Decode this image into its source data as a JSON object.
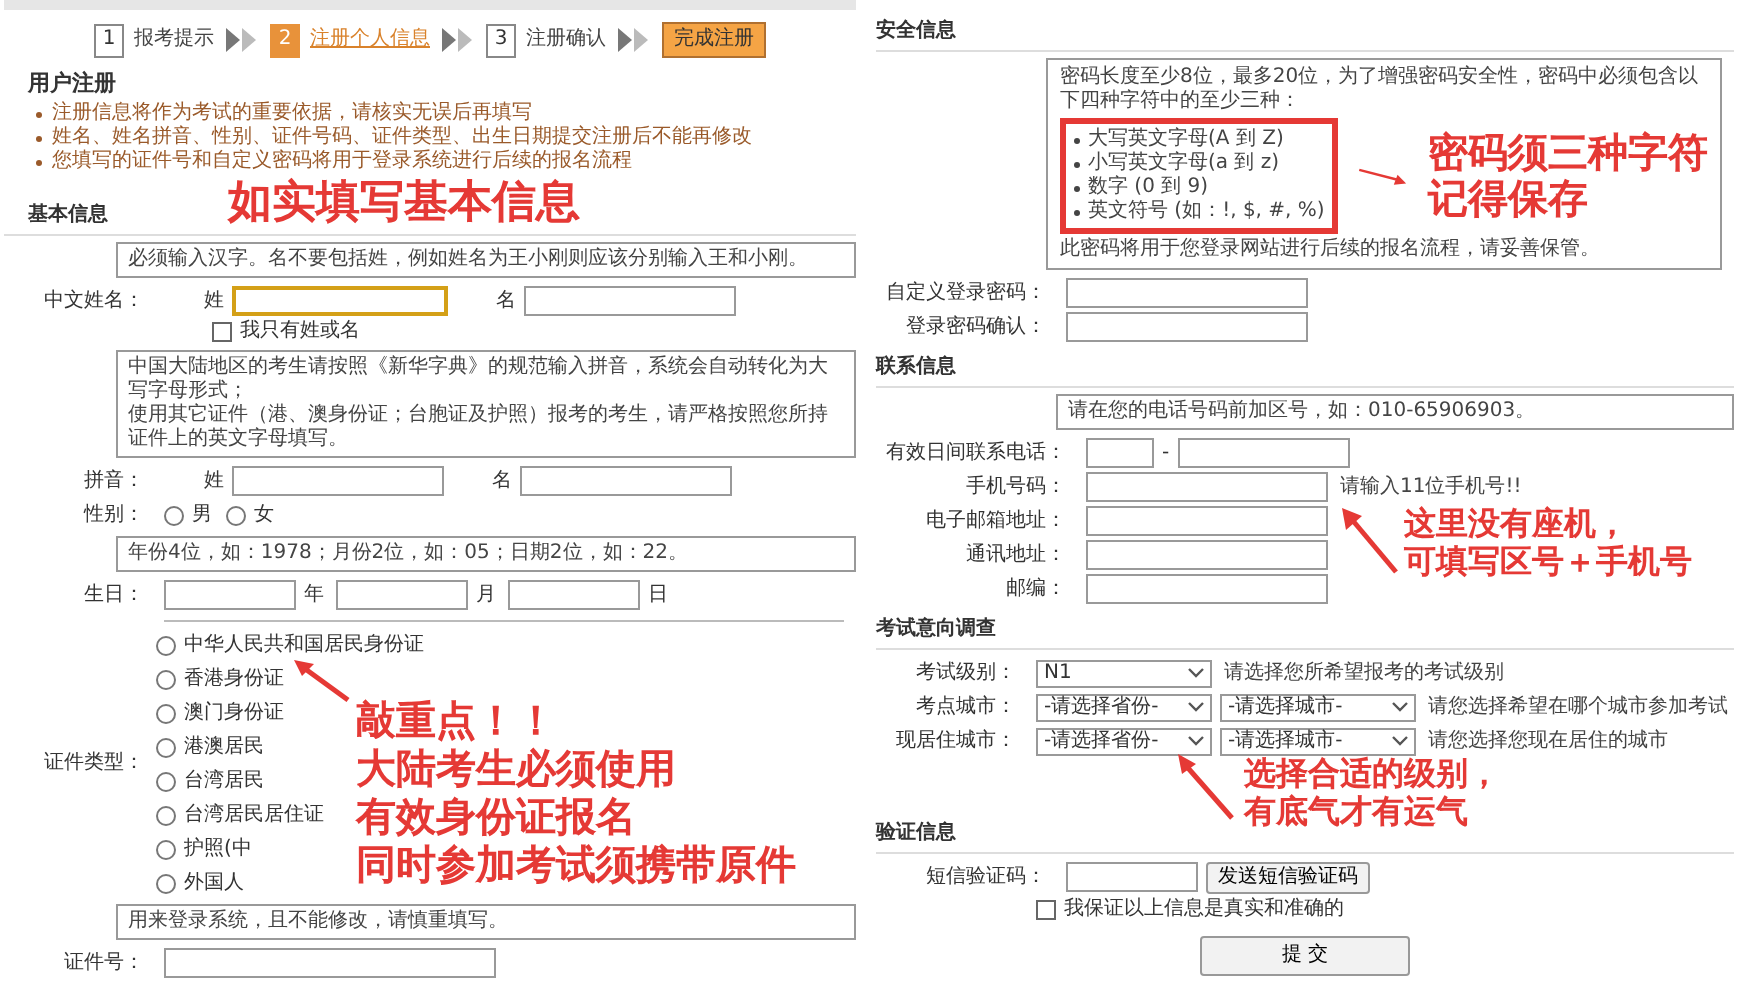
{
  "registration": {
    "steps": [
      {
        "number": "1",
        "label": "报考提示",
        "selected": false
      },
      {
        "number": "2",
        "label": "注册个人信息",
        "selected": true
      },
      {
        "number": "3",
        "label": "注册确认",
        "selected": false
      }
    ],
    "finish_label": "完成注册",
    "title": "用户注册",
    "notices": [
      "注册信息将作为考试的重要依据，请核实无误后再填写",
      "姓名、姓名拼音、性别、证件号码、证件类型、出生日期提交注册后不能再修改",
      "您填写的证件号和自定义密码将用于登录系统进行后续的报名流程"
    ],
    "basic": {
      "title": "基本信息",
      "annotation": "如实填写基本信息",
      "name_hint": "必须输入汉字。名不要包括姓，例如姓名为王小刚则应该分别输入王和小刚。",
      "name_label": "中文姓名：",
      "name_fields": [
        {
          "label": "姓",
          "focused": true
        },
        {
          "label": "名",
          "focused": false
        }
      ],
      "single_name": {
        "label": "我只有姓或名",
        "checked": false
      },
      "pinyin_hint": [
        "中国大陆地区的考生请按照《新华字典》的规范输入拼音，系统会自动转化为大写字母形式；",
        "使用其它证件（港、澳身份证；台胞证及护照）报考的考生，请严格按照您所持证件上的英文字母填写。"
      ],
      "pinyin_label": "拼音：",
      "pinyin_fields": [
        {
          "label": "姓",
          "focused": false
        },
        {
          "label": "名",
          "focused": false
        }
      ],
      "gender_label": "性别：",
      "genders": [
        {
          "label": "男",
          "selected": false
        },
        {
          "label": "女",
          "selected": false
        }
      ],
      "birth_hint": "年份4位，如：1978；月份2位，如：05；日期2位，如：22。",
      "birth_label": "生日：",
      "birth_units": [
        "年",
        "月",
        "日"
      ],
      "id_type_label": "证件类型：",
      "id_types": [
        {
          "label": "中华人民共和国居民身份证",
          "selected": false
        },
        {
          "label": "香港身份证",
          "selected": false
        },
        {
          "label": "澳门身份证",
          "selected": false
        },
        {
          "label": "港澳居民",
          "selected": false
        },
        {
          "label": "台湾居民",
          "selected": false
        },
        {
          "label": "台湾居民居住证",
          "selected": false
        },
        {
          "label": "护照(中",
          "selected": false
        },
        {
          "label": "外国人",
          "selected": false
        }
      ],
      "id_annotation": [
        "敲重点！！",
        "大陆考生必须使用",
        "有效身份证报名",
        "同时参加考试须携带原件"
      ],
      "id_hint": "用来登录系统，且不能修改，请慎重填写。",
      "id_number_label": "证件号："
    }
  },
  "account": {
    "security": {
      "title": "安全信息",
      "intro": "密码长度至少8位，最多20位，为了增强密码安全性，密码中必须包含以下四种字符中的至少三种：",
      "rules": [
        "大写英文字母(A 到 Z)",
        "小写英文字母(a 到 z)",
        "数字 (0 到 9)",
        "英文符号 (如：!, $, #, %)"
      ],
      "annotation": [
        "密码须三种字符",
        "记得保存"
      ],
      "note": "此密码将用于您登录网站进行后续的报名流程，请妥善保管。",
      "fields": [
        "自定义登录密码：",
        "登录密码确认："
      ]
    },
    "contact": {
      "title": "联系信息",
      "hint": "请在您的电话号码前加区号，如：010-65906903。",
      "phone_label": "有效日间联系电话：",
      "phone_separator": "-",
      "mobile_label": "手机号码：",
      "mobile_note": "请输入11位手机号!!",
      "fields": [
        "电子邮箱地址：",
        "通讯地址：",
        "邮编："
      ],
      "annotation": [
        "这里没有座机，",
        "可填写区号＋手机号"
      ]
    },
    "exam": {
      "title": "考试意向调查",
      "rows": [
        {
          "label": "考试级别：",
          "selects": [
            "N1"
          ],
          "note": "请选择您所希望报考的考试级别"
        },
        {
          "label": "考点城市：",
          "selects": [
            "-请选择省份-",
            "-请选择城市-"
          ],
          "note": "请您选择希望在哪个城市参加考试"
        },
        {
          "label": "现居住城市：",
          "selects": [
            "-请选择省份-",
            "-请选择城市-"
          ],
          "note": "请您选择您现在居住的城市"
        }
      ],
      "annotation": [
        "选择合适的级别，",
        "有底气才有运气"
      ]
    },
    "verify": {
      "title": "验证信息",
      "code_label": "短信验证码：",
      "send_button": "发送短信验证码",
      "agreement": {
        "label": "我保证以上信息是真实和准确的",
        "checked": false
      },
      "submit": "提 交"
    }
  }
}
